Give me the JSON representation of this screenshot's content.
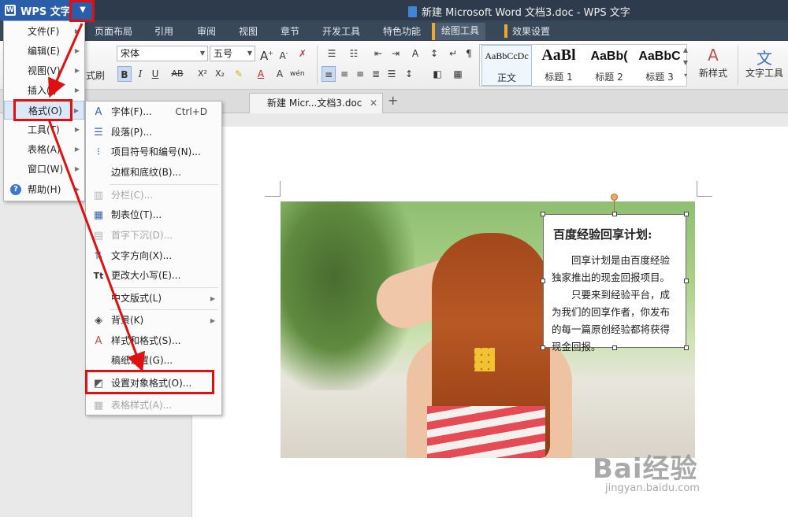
{
  "app": {
    "name": "WPS 文字",
    "dropdown_icon": "triangle-down-icon"
  },
  "window_title": "新建 Microsoft Word 文档3.doc - WPS 文字",
  "ribbon_tabs": [
    "页面布局",
    "引用",
    "审阅",
    "视图",
    "章节",
    "开发工具",
    "特色功能",
    "绘图工具",
    "效果设置"
  ],
  "ribbon": {
    "format_painter": "式刷",
    "font_name": "宋体",
    "font_size": "五号",
    "styles": [
      {
        "sample": "AaBbCcDc",
        "caption": "正文"
      },
      {
        "sample": "AaBl",
        "caption": "标题 1"
      },
      {
        "sample": "AaBb(",
        "caption": "标题 2"
      },
      {
        "sample": "AaBbC",
        "caption": "标题 3"
      }
    ],
    "new_style": "新样式",
    "text_tools": "文字工具"
  },
  "doc_tabs": [
    {
      "label": "新建 Micr...文档3.doc"
    }
  ],
  "main_menu": {
    "items": [
      "文件(F)",
      "编辑(E)",
      "视图(V)",
      "插入(I)",
      "格式(O)",
      "工具(T)",
      "表格(A)",
      "窗口(W)",
      "帮助(H)"
    ],
    "highlighted": "格式(O)"
  },
  "format_menu": {
    "items": [
      {
        "label": "字体(F)...",
        "shortcut": "Ctrl+D",
        "icon": "font-icon",
        "enabled": true
      },
      {
        "label": "段落(P)...",
        "icon": "paragraph-icon",
        "enabled": true
      },
      {
        "label": "项目符号和编号(N)...",
        "icon": "bullets-icon",
        "enabled": true
      },
      {
        "label": "边框和底纹(B)...",
        "icon": "",
        "enabled": true
      },
      {
        "label": "分栏(C)...",
        "icon": "columns-icon",
        "enabled": false
      },
      {
        "label": "制表位(T)...",
        "icon": "tab-stops-icon",
        "enabled": true
      },
      {
        "label": "首字下沉(D)...",
        "icon": "drop-cap-icon",
        "enabled": false
      },
      {
        "label": "文字方向(X)...",
        "icon": "text-direction-icon",
        "enabled": true
      },
      {
        "label": "更改大小写(E)...",
        "icon": "change-case-icon",
        "enabled": true
      },
      {
        "label": "中文版式(L)",
        "icon": "",
        "enabled": true,
        "submenu": true
      },
      {
        "label": "背景(K)",
        "icon": "background-icon",
        "enabled": true,
        "submenu": true
      },
      {
        "label": "样式和格式(S)...",
        "icon": "styles-icon",
        "enabled": true
      },
      {
        "label": "稿纸设置(G)...",
        "icon": "",
        "enabled": true
      },
      {
        "label": "设置对象格式(O)...",
        "icon": "object-format-icon",
        "enabled": true
      },
      {
        "label": "表格样式(A)...",
        "icon": "table-style-icon",
        "enabled": false
      }
    ]
  },
  "textbox": {
    "title": "百度经验回享计划:",
    "paragraphs": [
      "回享计划是由百度经验独家推出的现金回报项目。",
      "只要来到经验平台，成为我们的回享作者，你发布的每一篇原创经验都将获得现金回报。"
    ]
  },
  "watermark": {
    "brand": "Bai经验",
    "url": "jingyan.baidu.com"
  },
  "colors": {
    "accent": "#2a5ea8",
    "annotation": "#e01010",
    "titlebar": "#2e3b4c"
  }
}
